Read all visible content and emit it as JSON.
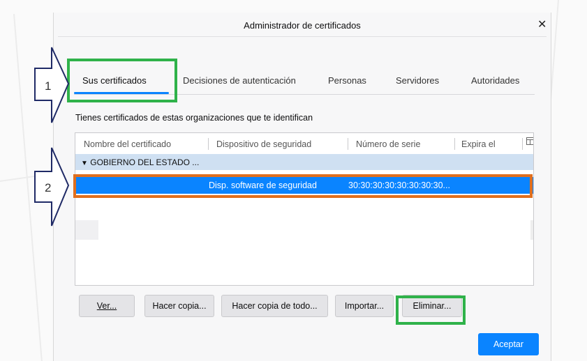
{
  "window": {
    "title": "Administrador de certificados",
    "close_icon": "close-icon"
  },
  "tabs": [
    {
      "label": "Sus certificados",
      "selected": true
    },
    {
      "label": "Decisiones de autenticación",
      "selected": false
    },
    {
      "label": "Personas",
      "selected": false
    },
    {
      "label": "Servidores",
      "selected": false
    },
    {
      "label": "Autoridades",
      "selected": false
    }
  ],
  "description": "Tienes certificados de estas organizaciones que te identifican",
  "table": {
    "columns": [
      "Nombre del certificado",
      "Dispositivo de seguridad",
      "Número de serie",
      "Expira el"
    ],
    "column_picker_icon": "column-picker-icon",
    "group": {
      "icon": "chevron-down-icon",
      "label": "GOBIERNO DEL ESTADO ..."
    },
    "selected_row": {
      "name": "",
      "device": "Disp. software de seguridad",
      "serial": "30:30:30:30:30:30:30:30...",
      "expires": ""
    }
  },
  "buttons": {
    "view": "Ver...",
    "backup": "Hacer copia...",
    "backup_all": "Hacer copia de todo...",
    "import": "Importar...",
    "delete": "Eliminar...",
    "accept": "Aceptar"
  },
  "annotations": {
    "callout_1": "1",
    "callout_2": "2"
  },
  "colors": {
    "accent": "#0a84ff",
    "highlight_green": "#2fb24a",
    "highlight_orange": "#e06f1e",
    "group_row": "#cfe0f2"
  }
}
